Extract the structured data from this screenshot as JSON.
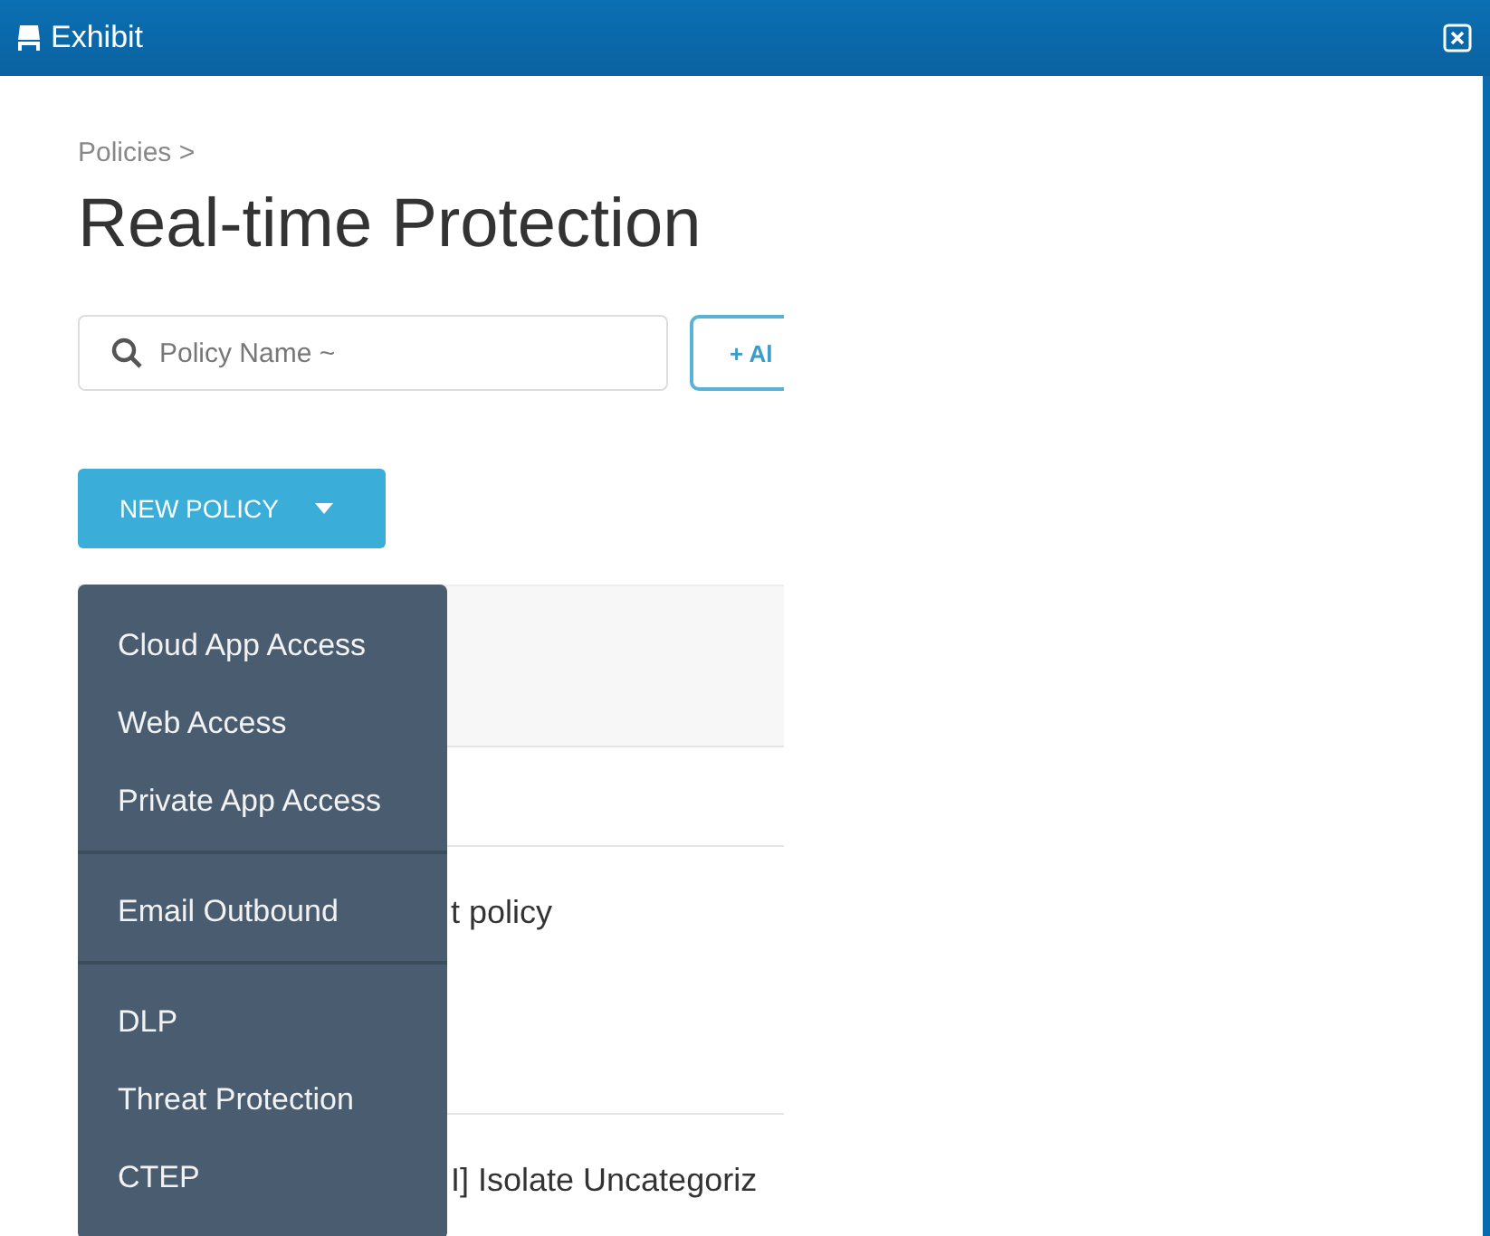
{
  "window": {
    "title": "Exhibit"
  },
  "breadcrumb": "Policies >",
  "page_title": "Real-time Protection",
  "search": {
    "placeholder": "Policy Name ~"
  },
  "add_button": "+ Al",
  "new_policy_button": "NEW POLICY",
  "menu": {
    "groups": [
      [
        "Cloud App Access",
        "Web Access",
        "Private App Access"
      ],
      [
        "Email Outbound"
      ],
      [
        "DLP",
        "Threat Protection",
        "CTEP"
      ]
    ]
  },
  "rows": [
    {
      "name": "t policy"
    },
    {
      "name": "I] Isolate Uncategoriz"
    }
  ]
}
